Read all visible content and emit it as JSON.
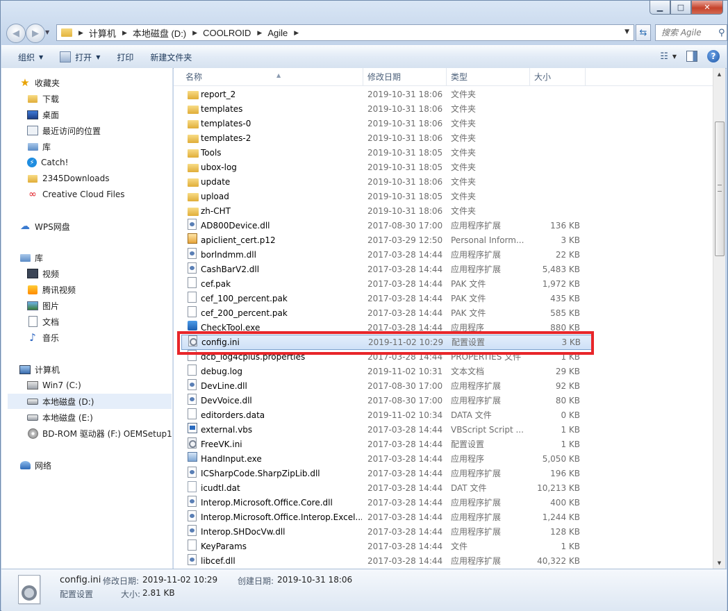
{
  "window": {
    "minimize_glyph": "▁",
    "maximize_glyph": "□",
    "close_glyph": "✕"
  },
  "address": {
    "crumbs": [
      "计算机",
      "本地磁盘 (D:)",
      "COOLROID",
      "Agile"
    ],
    "search_placeholder": "搜索 Agile"
  },
  "toolbar": {
    "organize": "组织",
    "open": "打开",
    "print": "打印",
    "new_folder": "新建文件夹"
  },
  "nav": {
    "favorites": "收藏夹",
    "downloads": "下载",
    "desktop": "桌面",
    "recent": "最近访问的位置",
    "lib_shortcut": "库",
    "catch": "Catch!",
    "downloads2345": "2345Downloads",
    "creative_cloud": "Creative Cloud Files",
    "wps": "WPS网盘",
    "libraries": "库",
    "videos": "视频",
    "tencent_video": "腾讯视频",
    "pictures": "图片",
    "documents": "文档",
    "music": "音乐",
    "computer": "计算机",
    "drive_c": "Win7 (C:)",
    "drive_d": "本地磁盘 (D:)",
    "drive_e": "本地磁盘 (E:)",
    "drive_f": "BD-ROM 驱动器 (F:) OEMSetup19",
    "network": "网络"
  },
  "columns": {
    "name": "名称",
    "modified": "修改日期",
    "type": "类型",
    "size": "大小"
  },
  "files": [
    {
      "name": "report_2",
      "date": "2019-10-31 18:06",
      "type": "文件夹",
      "size": "",
      "icon": "folder"
    },
    {
      "name": "templates",
      "date": "2019-10-31 18:06",
      "type": "文件夹",
      "size": "",
      "icon": "folder"
    },
    {
      "name": "templates-0",
      "date": "2019-10-31 18:06",
      "type": "文件夹",
      "size": "",
      "icon": "folder"
    },
    {
      "name": "templates-2",
      "date": "2019-10-31 18:06",
      "type": "文件夹",
      "size": "",
      "icon": "folder"
    },
    {
      "name": "Tools",
      "date": "2019-10-31 18:05",
      "type": "文件夹",
      "size": "",
      "icon": "folder"
    },
    {
      "name": "ubox-log",
      "date": "2019-10-31 18:05",
      "type": "文件夹",
      "size": "",
      "icon": "folder"
    },
    {
      "name": "update",
      "date": "2019-10-31 18:06",
      "type": "文件夹",
      "size": "",
      "icon": "folder"
    },
    {
      "name": "upload",
      "date": "2019-10-31 18:05",
      "type": "文件夹",
      "size": "",
      "icon": "folder"
    },
    {
      "name": "zh-CHT",
      "date": "2019-10-31 18:06",
      "type": "文件夹",
      "size": "",
      "icon": "folder"
    },
    {
      "name": "AD800Device.dll",
      "date": "2017-08-30 17:00",
      "type": "应用程序扩展",
      "size": "136 KB",
      "icon": "dll"
    },
    {
      "name": "apiclient_cert.p12",
      "date": "2017-03-29 12:50",
      "type": "Personal Inform...",
      "size": "3 KB",
      "icon": "cert"
    },
    {
      "name": "borlndmm.dll",
      "date": "2017-03-28 14:44",
      "type": "应用程序扩展",
      "size": "22 KB",
      "icon": "dll"
    },
    {
      "name": "CashBarV2.dll",
      "date": "2017-03-28 14:44",
      "type": "应用程序扩展",
      "size": "5,483 KB",
      "icon": "dll"
    },
    {
      "name": "cef.pak",
      "date": "2017-03-28 14:44",
      "type": "PAK 文件",
      "size": "1,972 KB",
      "icon": "plain"
    },
    {
      "name": "cef_100_percent.pak",
      "date": "2017-03-28 14:44",
      "type": "PAK 文件",
      "size": "435 KB",
      "icon": "plain"
    },
    {
      "name": "cef_200_percent.pak",
      "date": "2017-03-28 14:44",
      "type": "PAK 文件",
      "size": "585 KB",
      "icon": "plain"
    },
    {
      "name": "CheckTool.exe",
      "date": "2017-03-28 14:44",
      "type": "应用程序",
      "size": "880 KB",
      "icon": "exe"
    },
    {
      "name": "config.ini",
      "date": "2019-11-02 10:29",
      "type": "配置设置",
      "size": "3 KB",
      "icon": "cfg",
      "selected": true
    },
    {
      "name": "dcb_log4cplus.properties",
      "date": "2017-03-28 14:44",
      "type": "PROPERTIES 文件",
      "size": "1 KB",
      "icon": "plain"
    },
    {
      "name": "debug.log",
      "date": "2019-11-02 10:31",
      "type": "文本文档",
      "size": "29 KB",
      "icon": "plain"
    },
    {
      "name": "DevLine.dll",
      "date": "2017-08-30 17:00",
      "type": "应用程序扩展",
      "size": "92 KB",
      "icon": "dll"
    },
    {
      "name": "DevVoice.dll",
      "date": "2017-08-30 17:00",
      "type": "应用程序扩展",
      "size": "80 KB",
      "icon": "dll"
    },
    {
      "name": "editorders.data",
      "date": "2019-11-02 10:34",
      "type": "DATA 文件",
      "size": "0 KB",
      "icon": "plain"
    },
    {
      "name": "external.vbs",
      "date": "2017-03-28 14:44",
      "type": "VBScript Script ...",
      "size": "1 KB",
      "icon": "vbs"
    },
    {
      "name": "FreeVK.ini",
      "date": "2017-03-28 14:44",
      "type": "配置设置",
      "size": "1 KB",
      "icon": "cfg"
    },
    {
      "name": "HandInput.exe",
      "date": "2017-03-28 14:44",
      "type": "应用程序",
      "size": "5,050 KB",
      "icon": "tool"
    },
    {
      "name": "ICSharpCode.SharpZipLib.dll",
      "date": "2017-03-28 14:44",
      "type": "应用程序扩展",
      "size": "196 KB",
      "icon": "dll"
    },
    {
      "name": "icudtl.dat",
      "date": "2017-03-28 14:44",
      "type": "DAT 文件",
      "size": "10,213 KB",
      "icon": "dat"
    },
    {
      "name": "Interop.Microsoft.Office.Core.dll",
      "date": "2017-03-28 14:44",
      "type": "应用程序扩展",
      "size": "400 KB",
      "icon": "dll"
    },
    {
      "name": "Interop.Microsoft.Office.Interop.Excel...",
      "date": "2017-03-28 14:44",
      "type": "应用程序扩展",
      "size": "1,244 KB",
      "icon": "dll"
    },
    {
      "name": "Interop.SHDocVw.dll",
      "date": "2017-03-28 14:44",
      "type": "应用程序扩展",
      "size": "128 KB",
      "icon": "dll"
    },
    {
      "name": "KeyParams",
      "date": "2017-03-28 14:44",
      "type": "文件",
      "size": "1 KB",
      "icon": "plain"
    },
    {
      "name": "libcef.dll",
      "date": "2017-03-28 14:44",
      "type": "应用程序扩展",
      "size": "40,322 KB",
      "icon": "dll"
    }
  ],
  "details": {
    "filename": "config.ini",
    "modified_label": "修改日期:",
    "modified_value": "2019-11-02 10:29",
    "created_label": "创建日期:",
    "created_value": "2019-10-31 18:06",
    "type": "配置设置",
    "size_label": "大小:",
    "size_value": "2.81 KB"
  }
}
